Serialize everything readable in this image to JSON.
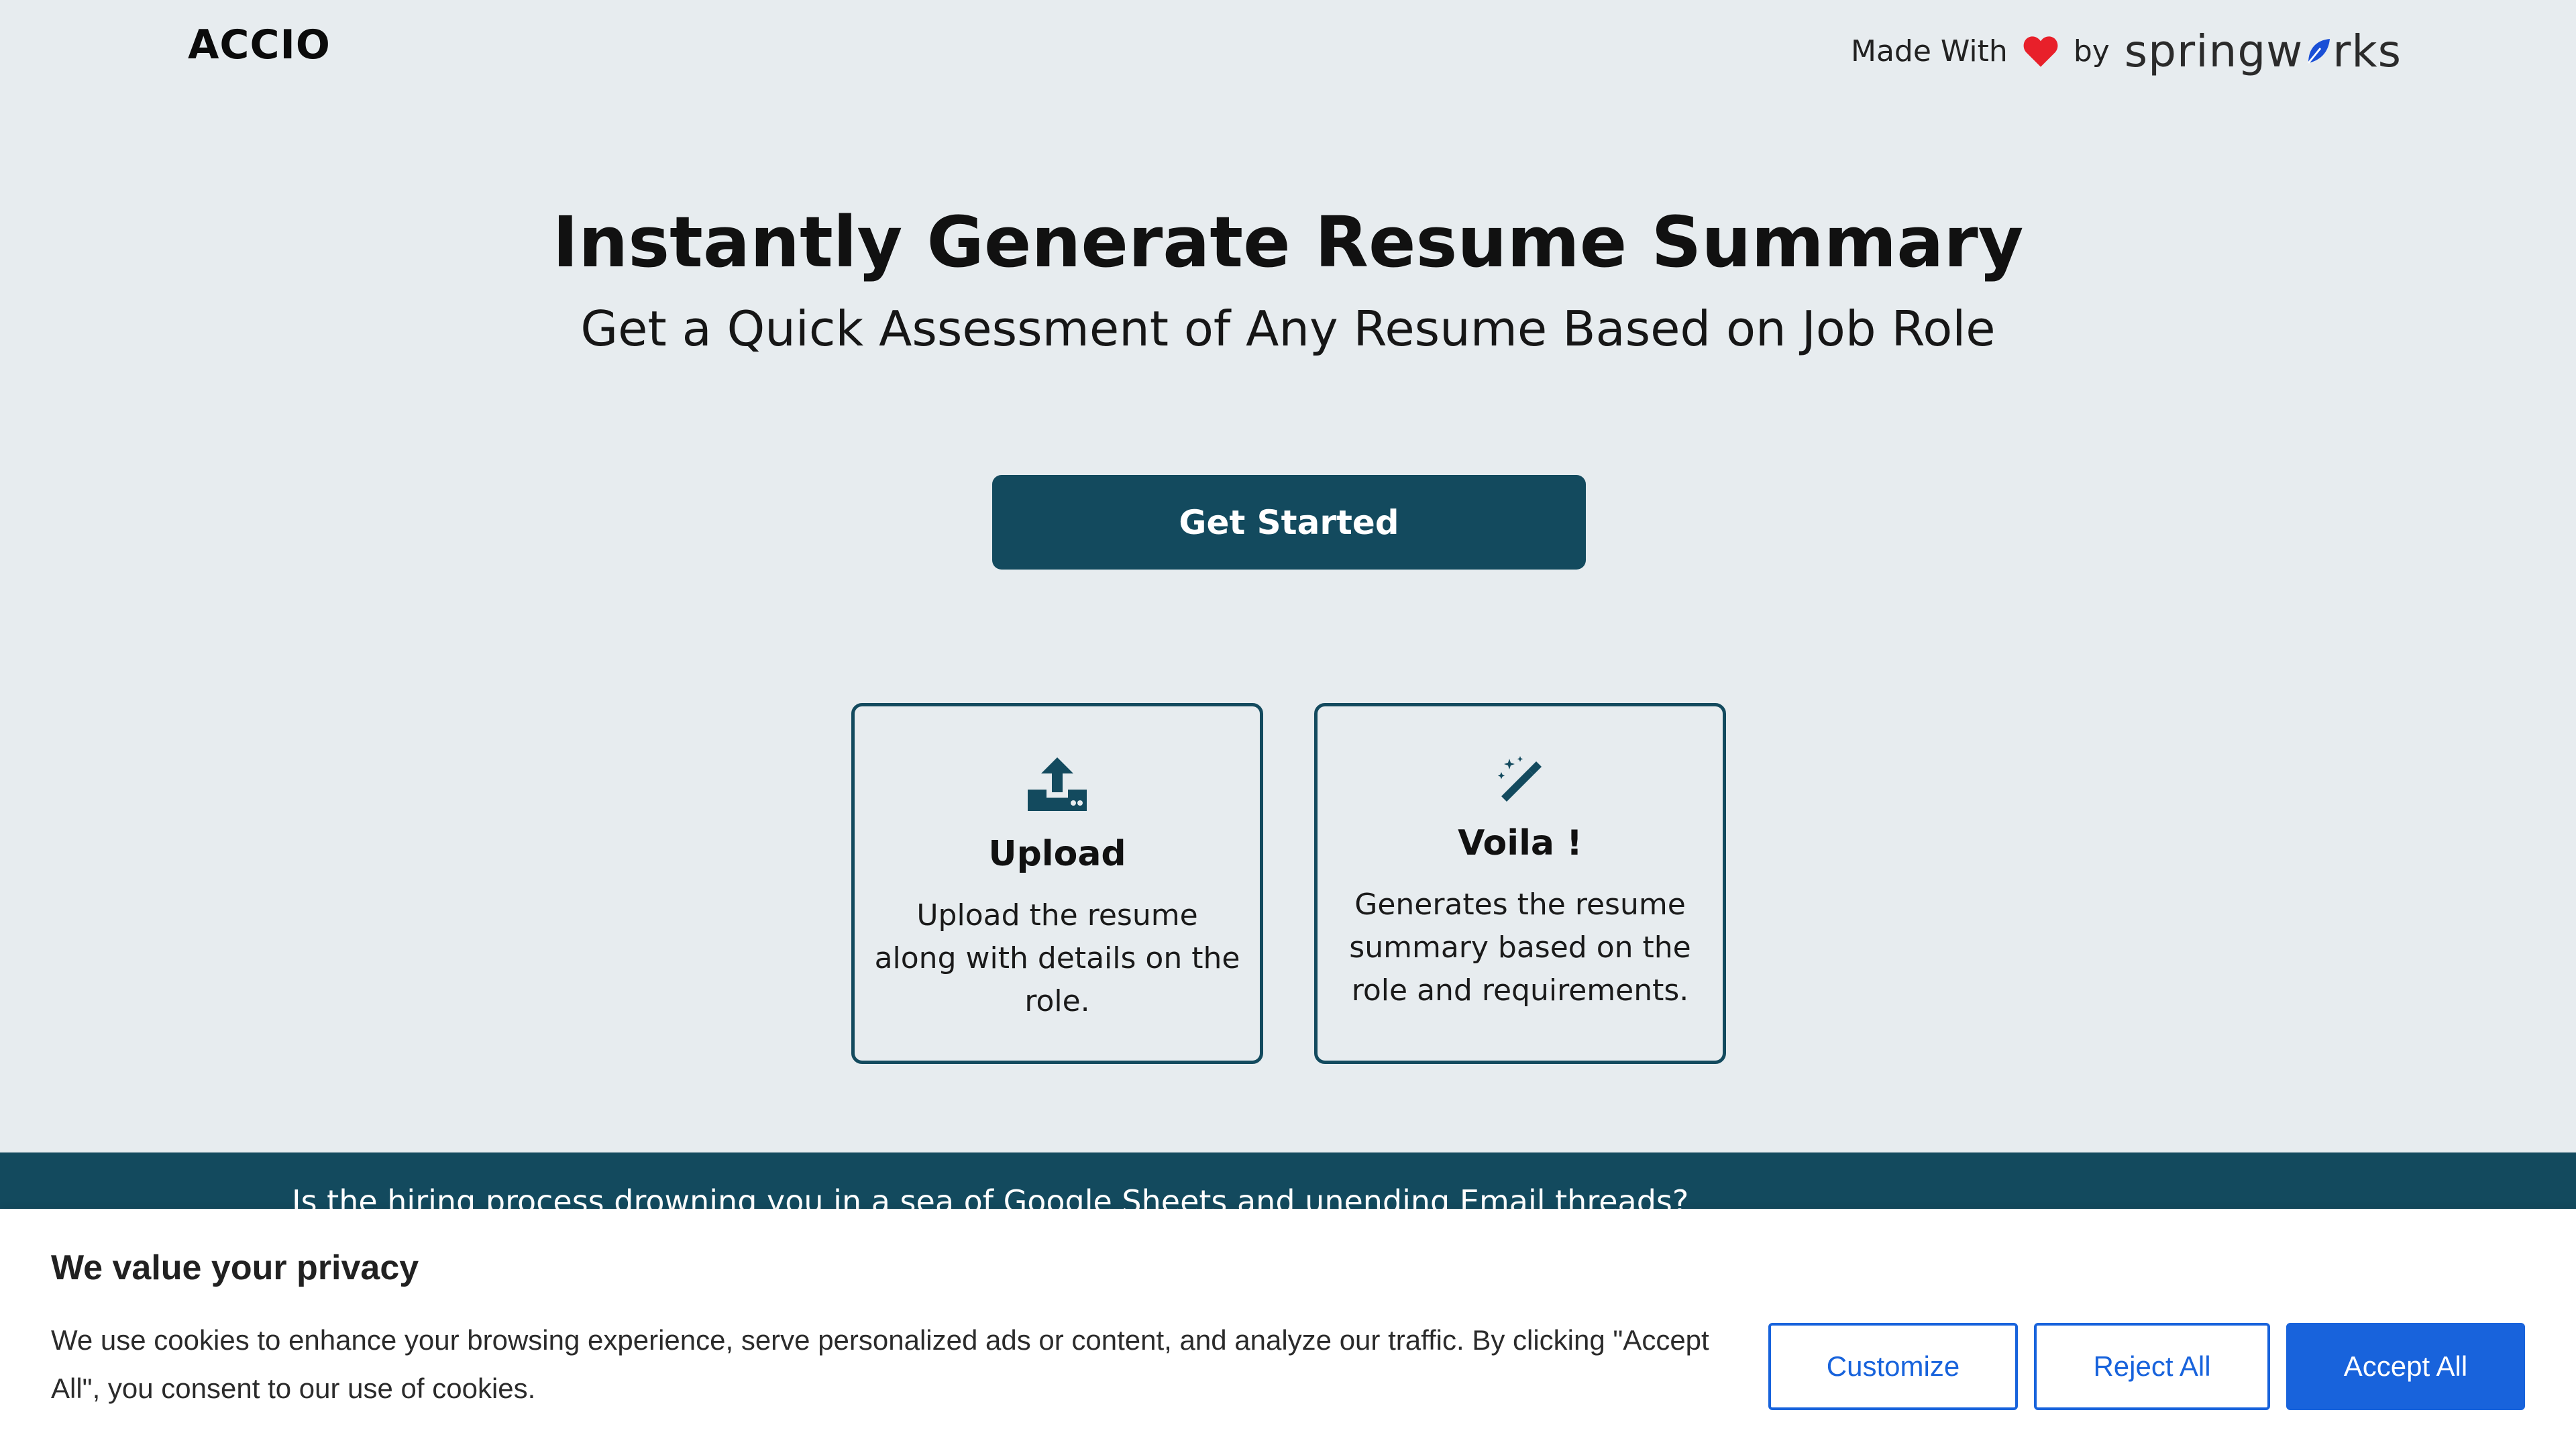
{
  "header": {
    "logo": "ACCIO",
    "credit_prefix": "Made With",
    "credit_by": "by",
    "brand_left": "springw",
    "brand_right": "rks"
  },
  "hero": {
    "title": "Instantly Generate Resume Summary",
    "subtitle": "Get a Quick Assessment of Any Resume Based on Job Role",
    "cta_label": "Get Started"
  },
  "cards": [
    {
      "icon": "upload-icon",
      "title": "Upload",
      "text": "Upload the resume along with details on the role."
    },
    {
      "icon": "magic-wand-icon",
      "title": "Voila !",
      "text": "Generates the resume summary based on the role and requirements."
    }
  ],
  "band": {
    "text": "Is the hiring process drowning you in a sea of Google Sheets and unending Email threads?"
  },
  "cookie_banner": {
    "title": "We value your privacy",
    "text": "We use cookies to enhance your browsing experience, serve personalized ads or content, and analyze our traffic. By clicking \"Accept All\", you consent to our use of cookies.",
    "customize_label": "Customize",
    "reject_label": "Reject All",
    "accept_label": "Accept All"
  },
  "colors": {
    "background": "#e7ecef",
    "primary": "#134a5e",
    "heart": "#e8202a",
    "cookie_accent": "#1863dc"
  }
}
